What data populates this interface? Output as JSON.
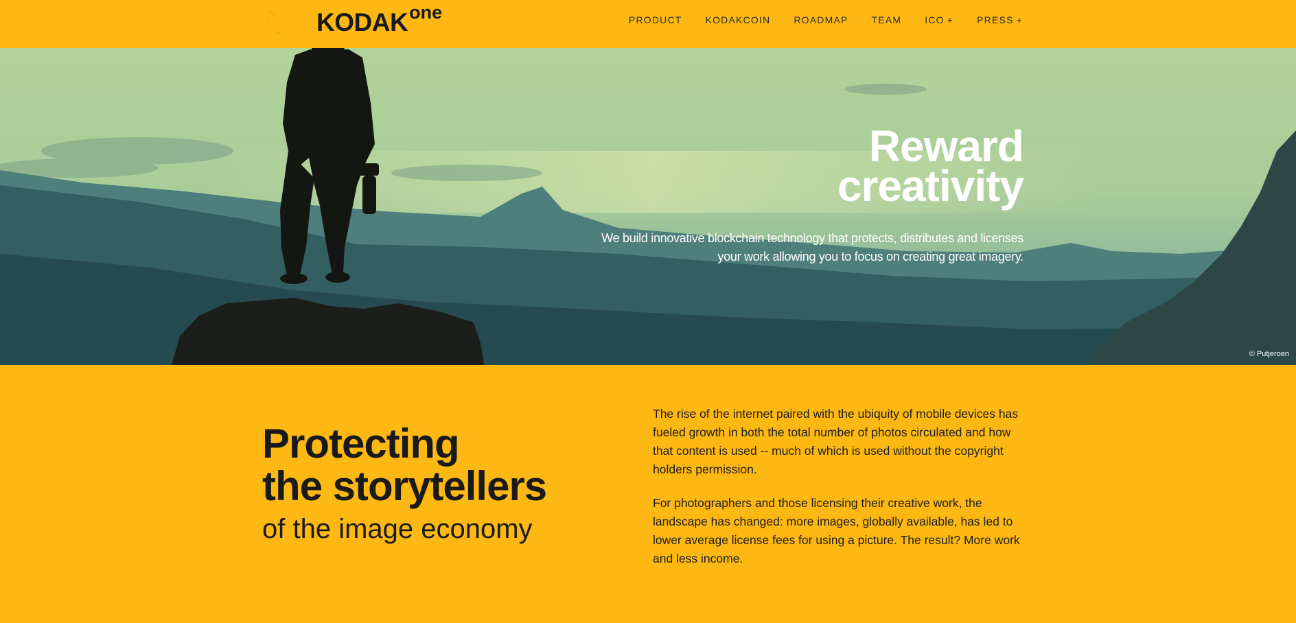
{
  "header": {
    "logo": {
      "brand": "KODAK",
      "suffix": "one"
    },
    "nav": [
      {
        "label": "PRODUCT",
        "name": "nav-product",
        "suffix": ""
      },
      {
        "label": "KODAKCOIN",
        "name": "nav-kodakcoin",
        "suffix": ""
      },
      {
        "label": "ROADMAP",
        "name": "nav-roadmap",
        "suffix": ""
      },
      {
        "label": "TEAM",
        "name": "nav-team",
        "suffix": ""
      },
      {
        "label": "ICO",
        "name": "nav-ico",
        "suffix": "+"
      },
      {
        "label": "PRESS",
        "name": "nav-press",
        "suffix": "+"
      }
    ]
  },
  "hero": {
    "title_line1": "Reward",
    "title_line2": "creativity",
    "subtitle": "We build innovative blockchain technology that protects, distributes and licenses your work allowing you to focus on creating great imagery.",
    "credit": "© Putjeroen"
  },
  "content": {
    "headline_line1": "Protecting",
    "headline_line2": "the storytellers",
    "headline_line3": "of the image economy",
    "paragraphs": [
      "The rise of the internet paired with the ubiquity of mobile devices has fueled growth in both the total number of photos circulated and how that content is used -- much of which is used without the copyright holders permission.",
      "For photographers and those licensing their creative work, the landscape has changed: more images, globally available, has led to lower average license fees for using a picture. The result? More work and less income."
    ]
  },
  "colors": {
    "brand_yellow": "#FDB813",
    "text_dark": "#1a1a1a",
    "hero_text": "#ffffff"
  }
}
